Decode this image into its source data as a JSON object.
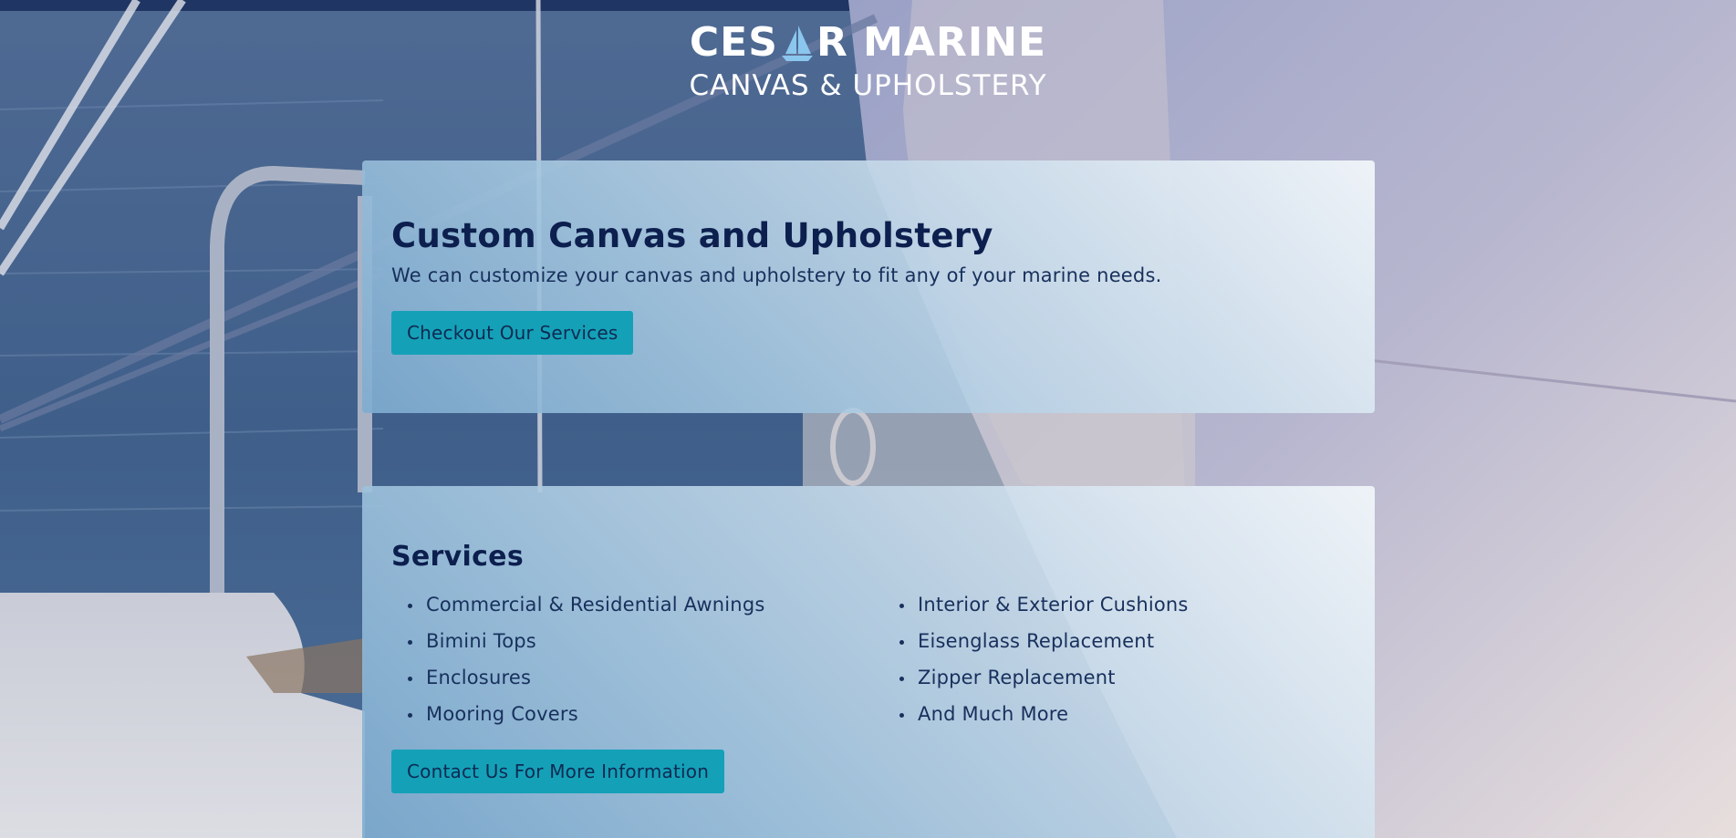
{
  "brand": {
    "title_before": "CES",
    "title_after": "R MARINE",
    "logo_icon": "sailboat-icon",
    "subtitle": "CANVAS & UPHOLSTERY"
  },
  "hero": {
    "heading": "Custom Canvas and Upholstery",
    "text": "We can customize your canvas and upholstery to fit any of your marine needs.",
    "button_label": "Checkout Our Services"
  },
  "services": {
    "heading": "Services",
    "left_items": [
      "Commercial & Residential Awnings",
      "Bimini Tops",
      "Enclosures",
      "Mooring Covers"
    ],
    "right_items": [
      "Interior & Exterior Cushions",
      "Eisenglass Replacement",
      "Zipper Replacement",
      "And Much More"
    ],
    "button_label": "Contact Us For More Information"
  },
  "colors": {
    "accent_button": "#14a1b8",
    "heading_text": "#0c1f4e",
    "header_text": "#ffffff"
  }
}
